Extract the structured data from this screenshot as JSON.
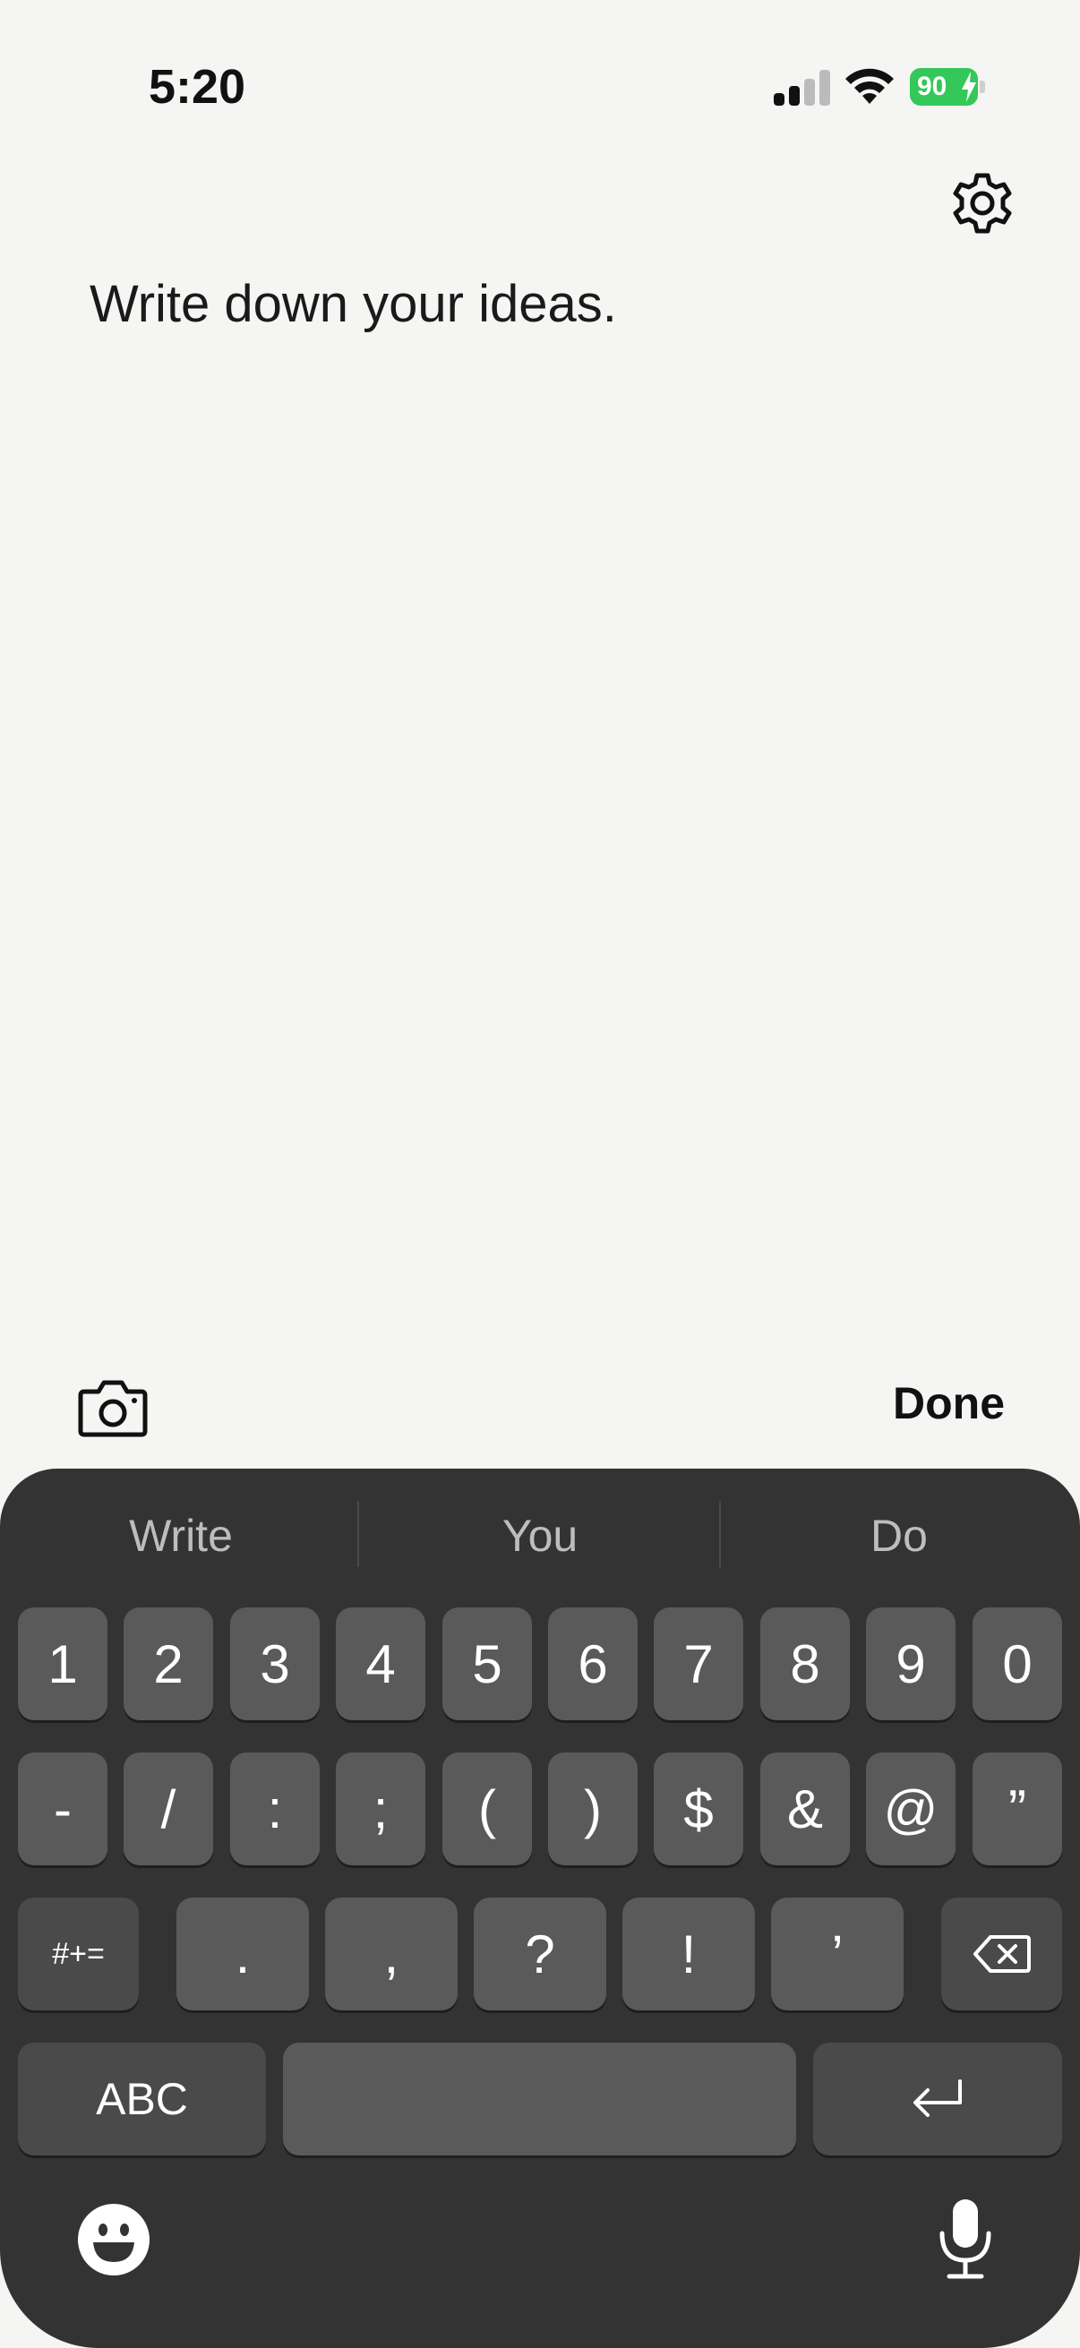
{
  "status_bar": {
    "time": "5:20",
    "battery": "90"
  },
  "note": {
    "placeholder": "Write down your ideas."
  },
  "accessory": {
    "done_label": "Done"
  },
  "keyboard": {
    "suggestions": [
      "Write",
      "You",
      "Do"
    ],
    "row1": [
      "1",
      "2",
      "3",
      "4",
      "5",
      "6",
      "7",
      "8",
      "9",
      "0"
    ],
    "row2": [
      "-",
      "/",
      ":",
      ";",
      "(",
      ")",
      "$",
      "&",
      "@",
      "”"
    ],
    "row3": {
      "left": "#+=",
      "keys": [
        ".",
        ",",
        "?",
        "!",
        "’"
      ]
    },
    "row4": {
      "abc": "ABC"
    }
  }
}
